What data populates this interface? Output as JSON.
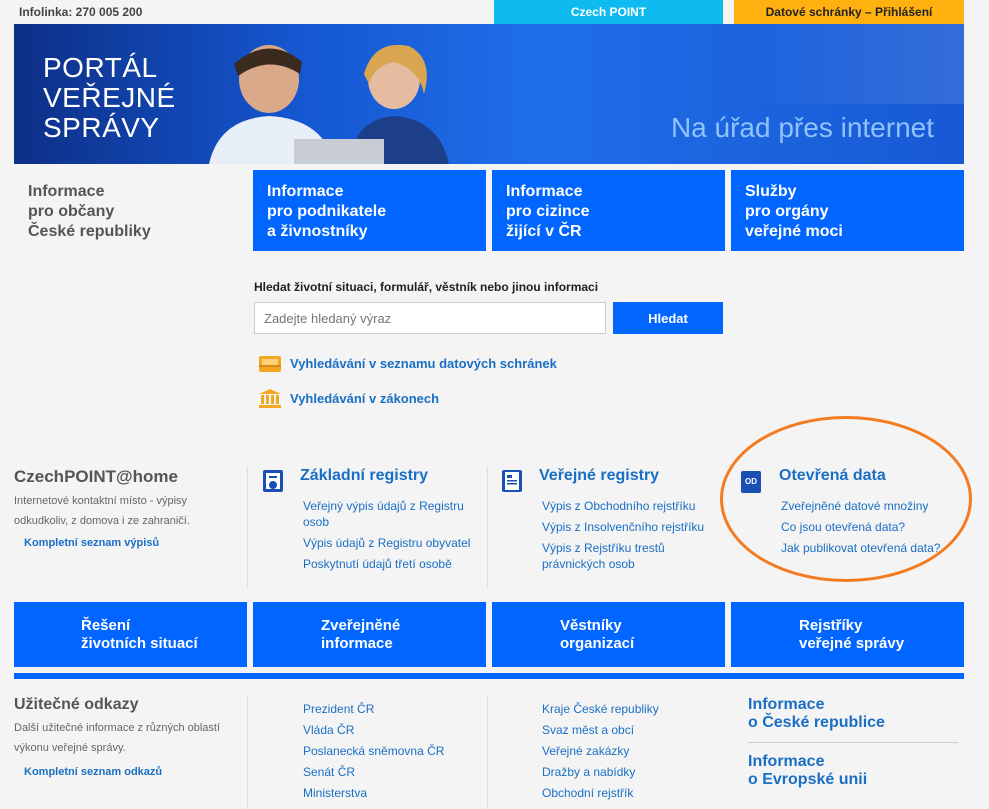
{
  "topbar": {
    "infoline": "Infolinka: 270 005 200",
    "czech_point": "Czech POINT",
    "datove": "Datové schránky – Přihlášení"
  },
  "banner": {
    "portal_line1": "PORTÁL",
    "portal_line2": "VEŘEJNÉ",
    "portal_line3": "SPRÁVY",
    "slogan": "Na úřad přes internet"
  },
  "nav": {
    "citizens": [
      "Informace",
      "pro občany",
      "České republiky"
    ],
    "business": [
      "Informace",
      "pro podnikatele",
      "a živnostníky"
    ],
    "foreigners": [
      "Informace",
      "pro cizince",
      "žijící v ČR"
    ],
    "authorities": [
      "Služby",
      "pro orgány",
      "veřejné moci"
    ]
  },
  "search": {
    "label": "Hledat životní situaci, formulář, věstník nebo jinou informaci",
    "placeholder": "Zadejte hledaný výraz",
    "button": "Hledat"
  },
  "quick_links": {
    "datove_schranky": "Vyhledávání v seznamu datových schránek",
    "zakony": "Vyhledávání v zákonech"
  },
  "czechpoint": {
    "title": "CzechPOINT@home",
    "desc": "Internetové kontaktní místo - výpisy odkudkoliv, z domova i ze zahraničí.",
    "link": "Kompletní seznam výpisů"
  },
  "zakladni": {
    "title": "Základní registry",
    "items": [
      "Veřejný výpis údajů z Registru osob",
      "Výpis údajů z Registru obyvatel",
      "Poskytnutí údajů třetí osobě"
    ]
  },
  "verejne": {
    "title": "Veřejné registry",
    "items": [
      "Výpis z Obchodního rejstříku",
      "Výpis z Insolvenčního rejstříku",
      "Výpis z Rejstříku trestů právnických osob"
    ]
  },
  "otevrena": {
    "icon_label": "OD",
    "title": "Otevřená data",
    "items": [
      "Zveřejněné datové množiny",
      "Co jsou otevřená data?",
      "Jak publikovat otevřená data?"
    ]
  },
  "big_tiles": {
    "t1": [
      "Řešení",
      "životních situací"
    ],
    "t2": [
      "Zveřejněné",
      "informace"
    ],
    "t3": [
      "Věstníky",
      "organizací"
    ],
    "t4": [
      "Rejstříky",
      "veřejné správy"
    ]
  },
  "useful": {
    "title": "Užitečné odkazy",
    "desc": "Další užitečné informace z různých oblastí výkonu veřejné správy.",
    "link": "Kompletní seznam odkazů",
    "list1": [
      "Prezident ČR",
      "Vláda ČR",
      "Poslanecká sněmovna ČR",
      "Senát ČR",
      "Ministerstva"
    ],
    "list2": [
      "Kraje České republiky",
      "Svaz měst a obcí",
      "Veřejné zakázky",
      "Dražby a nabídky",
      "Obchodní rejstřík"
    ]
  },
  "info_boxes": {
    "cr": [
      "Informace",
      "o České republice"
    ],
    "eu": [
      "Informace",
      "o Evropské unii"
    ]
  },
  "colors": {
    "brand_blue": "#0066ff",
    "czech_point": "#0ebaf0",
    "datove": "#ffb20f",
    "highlight": "#f47b20"
  }
}
